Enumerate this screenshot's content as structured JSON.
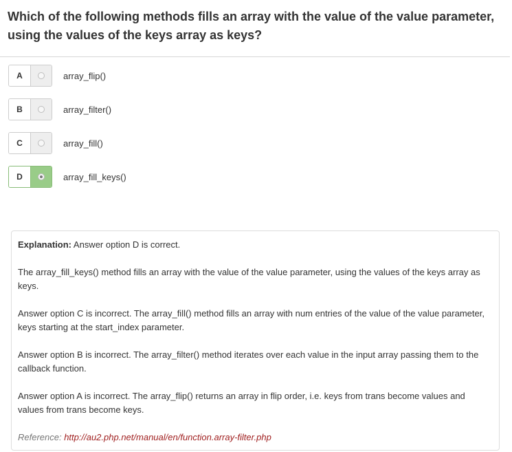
{
  "question": "Which of the following methods fills an array with the value of the value parameter, using the values of the keys array as keys?",
  "options": [
    {
      "letter": "A",
      "text": "array_flip()",
      "selected": false
    },
    {
      "letter": "B",
      "text": "array_filter()",
      "selected": false
    },
    {
      "letter": "C",
      "text": "array_fill()",
      "selected": false
    },
    {
      "letter": "D",
      "text": "array_fill_keys()",
      "selected": true
    }
  ],
  "explanation": {
    "label": "Explanation:",
    "summary": " Answer option D is correct.",
    "paragraphs": [
      "The array_fill_keys() method fills an array with the value of the value parameter, using the values of the keys array as keys.",
      "Answer option C is incorrect. The array_fill() method fills an array with num entries of the value of the value parameter, keys starting at the start_index parameter.",
      "Answer option B is incorrect. The array_filter() method iterates over each value in the input array passing them to the callback function.",
      "Answer option A is incorrect. The array_flip() returns an array in flip order, i.e. keys from trans become values and values from trans become keys."
    ],
    "reference_label": "Reference: ",
    "reference_url": "http://au2.php.net/manual/en/function.array-filter.php"
  },
  "colors": {
    "selected_fill": "#99cc88",
    "link": "#a02020"
  }
}
